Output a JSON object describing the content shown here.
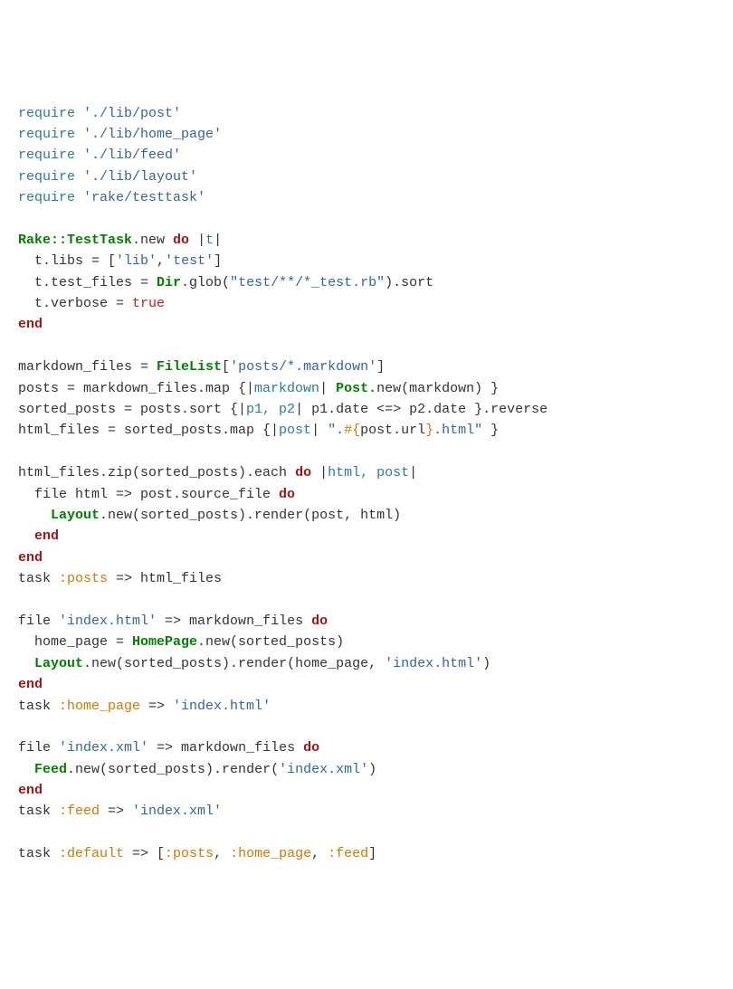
{
  "lines": {
    "l1_require": "require",
    "l1_str": "'./lib/post'",
    "l2_require": "require",
    "l2_str": "'./lib/home_page'",
    "l3_require": "require",
    "l3_str": "'./lib/feed'",
    "l4_require": "require",
    "l4_str": "'./lib/layout'",
    "l5_require": "require",
    "l5_str": "'rake/testtask'",
    "l7_class": "Rake::TestTask",
    "l7_new": ".new ",
    "l7_do": "do",
    "l7_pipe1": " |",
    "l7_t": "t",
    "l7_pipe2": "|",
    "l8": "  t.libs = [",
    "l8_s1": "'lib'",
    "l8_c": ",",
    "l8_s2": "'test'",
    "l8_end": "]",
    "l9_a": "  t.test_files = ",
    "l9_dir": "Dir",
    "l9_b": ".glob(",
    "l9_str": "\"test/**/*_test.rb\"",
    "l9_c": ").sort",
    "l10_a": "  t.verbose = ",
    "l10_true": "true",
    "l11_end": "end",
    "l13_a": "markdown_files = ",
    "l13_fl": "FileList",
    "l13_b": "[",
    "l13_str": "'posts/*.markdown'",
    "l13_c": "]",
    "l14_a": "posts = markdown_files.map {|",
    "l14_p": "markdown",
    "l14_b": "| ",
    "l14_post": "Post",
    "l14_c": ".new(markdown) }",
    "l15_a": "sorted_posts = posts.sort {|",
    "l15_p": "p1, p2",
    "l15_b": "| p1.date <=> p2.date }.reverse",
    "l16_a": "html_files = sorted_posts.map {|",
    "l16_p": "post",
    "l16_b": "| ",
    "l16_s1": "\".",
    "l16_i1": "#{",
    "l16_i2": "post.url",
    "l16_i3": "}",
    "l16_s2": ".html\"",
    "l16_c": " }",
    "l18_a": "html_files.zip(sorted_posts).each ",
    "l18_do": "do",
    "l18_b": " |",
    "l18_p": "html, post",
    "l18_c": "|",
    "l19_a": "  file html => post.source_file ",
    "l19_do": "do",
    "l20_a": "    ",
    "l20_layout": "Layout",
    "l20_b": ".new(sorted_posts).render(post, html)",
    "l21_end": "  end",
    "l21_kw": "end",
    "l21_sp": "  ",
    "l22_end": "end",
    "l23_a": "task ",
    "l23_sym": ":posts",
    "l23_b": " => html_files",
    "l25_a": "file ",
    "l25_str": "'index.html'",
    "l25_b": " => markdown_files ",
    "l25_do": "do",
    "l26_a": "  home_page = ",
    "l26_hp": "HomePage",
    "l26_b": ".new(sorted_posts)",
    "l27_a": "  ",
    "l27_layout": "Layout",
    "l27_b": ".new(sorted_posts).render(home_page, ",
    "l27_str": "'index.html'",
    "l27_c": ")",
    "l28_end": "end",
    "l29_a": "task ",
    "l29_sym": ":home_page",
    "l29_b": " => ",
    "l29_str": "'index.html'",
    "l31_a": "file ",
    "l31_str": "'index.xml'",
    "l31_b": " => markdown_files ",
    "l31_do": "do",
    "l32_a": "  ",
    "l32_feed": "Feed",
    "l32_b": ".new(sorted_posts).render(",
    "l32_str": "'index.xml'",
    "l32_c": ")",
    "l33_end": "end",
    "l34_a": "task ",
    "l34_sym": ":feed",
    "l34_b": " => ",
    "l34_str": "'index.xml'",
    "l36_a": "task ",
    "l36_sym1": ":default",
    "l36_b": " => [",
    "l36_sym2": ":posts",
    "l36_c": ", ",
    "l36_sym3": ":home_page",
    "l36_d": ", ",
    "l36_sym4": ":feed",
    "l36_e": "]"
  }
}
